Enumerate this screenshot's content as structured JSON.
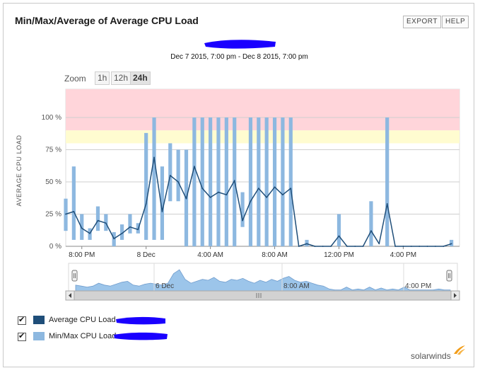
{
  "header": {
    "title": "Min/Max/Average of Average CPU Load",
    "export_label": "EXPORT",
    "help_label": "HELP"
  },
  "subtitle": "Dec 7 2015, 7:00 pm - Dec 8 2015, 7:00 pm",
  "zoom": {
    "label": "Zoom",
    "options": [
      "1h",
      "12h",
      "24h"
    ],
    "active": "24h"
  },
  "colors": {
    "average_series": "#1f4e79",
    "minmax_series": "#8db8e0",
    "critical_band": "#ffd5da",
    "warning_band": "#fffcd0",
    "navigator_fill": "#9cc5ea",
    "redaction": "#1a00ff"
  },
  "chart_data": {
    "type": "bar",
    "ylabel": "AVERAGE CPU LOAD",
    "ylim": [
      0,
      122
    ],
    "y_ticks": [
      "0 %",
      "25 %",
      "50 %",
      "75 %",
      "100 %"
    ],
    "y_tick_values": [
      0,
      25,
      50,
      75,
      100
    ],
    "x_tick_labels": [
      "8:00 PM",
      "8 Dec",
      "4:00 AM",
      "8:00 AM",
      "12:00 PM",
      "4:00 PM"
    ],
    "x_tick_hours": [
      1,
      5,
      9,
      13,
      17,
      21
    ],
    "x_range_hours": [
      0,
      24.5
    ],
    "thresholds": {
      "warning": 80,
      "critical": 90
    },
    "series": [
      {
        "name": "Min/Max CPU Load",
        "kind": "range-bar",
        "hours": [
          0.0,
          0.5,
          1.0,
          1.5,
          2.0,
          2.5,
          3.0,
          3.5,
          4.0,
          4.5,
          5.0,
          5.5,
          6.0,
          6.5,
          7.0,
          7.5,
          8.0,
          8.5,
          9.0,
          9.5,
          10.0,
          10.5,
          11.0,
          11.5,
          12.0,
          12.5,
          13.0,
          13.5,
          14.0,
          14.5,
          15.0,
          15.5,
          16.0,
          16.5,
          17.0,
          17.5,
          18.0,
          18.5,
          19.0,
          19.5,
          20.0,
          20.5,
          21.0,
          21.5,
          22.0,
          22.5,
          23.0,
          23.5,
          24.0
        ],
        "min": [
          12,
          5,
          5,
          5,
          12,
          12,
          0,
          5,
          10,
          10,
          5,
          5,
          5,
          35,
          35,
          0,
          0,
          0,
          0,
          0,
          0,
          0,
          15,
          0,
          0,
          0,
          0,
          0,
          0,
          0,
          0,
          0,
          0,
          0,
          0,
          0,
          0,
          0,
          0,
          0,
          0,
          0,
          0,
          0,
          0,
          0,
          0,
          0,
          0
        ],
        "max": [
          37,
          62,
          25,
          14,
          31,
          25,
          11,
          17,
          25,
          18,
          88,
          100,
          62,
          80,
          75,
          75,
          100,
          100,
          100,
          100,
          100,
          100,
          42,
          100,
          100,
          100,
          100,
          100,
          100,
          0,
          5,
          0,
          0,
          0,
          25,
          0,
          0,
          0,
          35,
          0,
          100,
          0,
          0,
          0,
          0,
          0,
          0,
          0,
          5
        ]
      },
      {
        "name": "Average CPU Load",
        "kind": "line",
        "hours": [
          0.0,
          0.5,
          1.0,
          1.5,
          2.0,
          2.5,
          3.0,
          3.5,
          4.0,
          4.5,
          5.0,
          5.5,
          6.0,
          6.5,
          7.0,
          7.5,
          8.0,
          8.5,
          9.0,
          9.5,
          10.0,
          10.5,
          11.0,
          11.5,
          12.0,
          12.5,
          13.0,
          13.5,
          14.0,
          14.5,
          15.0,
          15.5,
          16.0,
          16.5,
          17.0,
          17.5,
          18.0,
          18.5,
          19.0,
          19.5,
          20.0,
          20.5,
          21.0,
          21.5,
          22.0,
          22.5,
          23.0,
          23.5,
          24.0
        ],
        "values": [
          25,
          27,
          14,
          10,
          20,
          18,
          6,
          10,
          15,
          13,
          33,
          69,
          27,
          55,
          50,
          37,
          62,
          45,
          38,
          42,
          40,
          51,
          20,
          35,
          45,
          38,
          46,
          40,
          45,
          0,
          2,
          0,
          0,
          0,
          8,
          0,
          0,
          0,
          12,
          2,
          33,
          0,
          0,
          0,
          0,
          0,
          0,
          0,
          2
        ]
      }
    ],
    "navigator": {
      "x_tick_labels": [
        "6 Dec",
        "8:00 AM",
        "4:00 PM"
      ],
      "values": [
        6,
        5,
        4,
        5,
        8,
        6,
        5,
        7,
        9,
        10,
        6,
        5,
        7,
        8,
        7,
        6,
        8,
        18,
        22,
        12,
        8,
        10,
        12,
        11,
        14,
        10,
        9,
        12,
        11,
        13,
        10,
        8,
        11,
        9,
        12,
        10,
        13,
        15,
        11,
        9,
        10,
        8,
        6,
        5,
        2,
        1,
        1,
        4,
        1,
        2,
        1,
        4,
        1,
        3,
        1,
        2,
        1,
        4,
        1,
        1,
        1,
        1,
        1,
        2,
        1,
        1
      ]
    }
  },
  "legend": [
    {
      "label": "Average CPU Load",
      "checked": true
    },
    {
      "label": "Min/Max CPU Load",
      "checked": true
    }
  ],
  "branding": {
    "logo_text": "solarwinds"
  }
}
